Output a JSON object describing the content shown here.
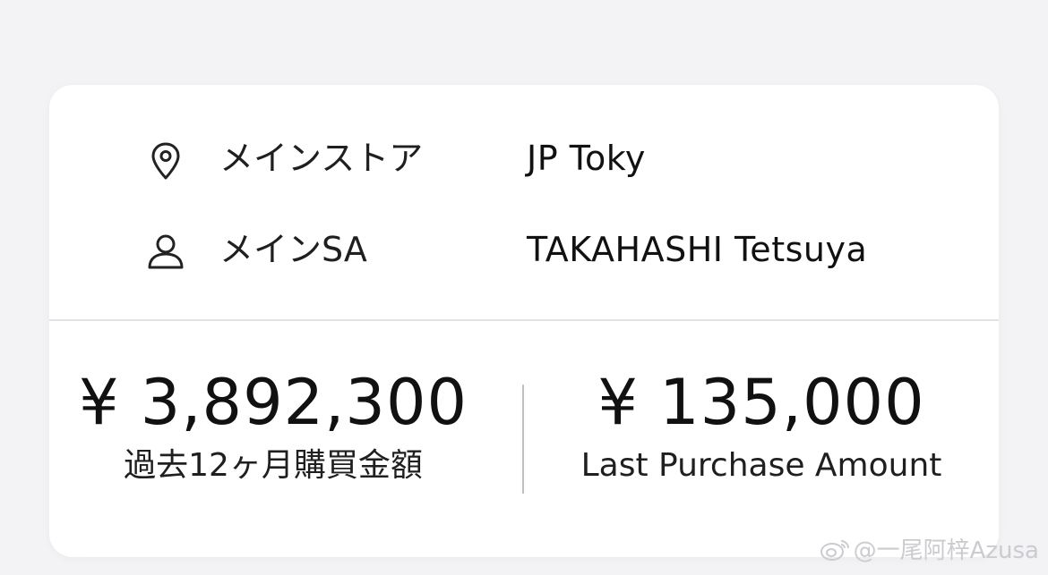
{
  "main_info": {
    "store_label": "メインストア",
    "store_value": "JP Toky",
    "store_icon": "location-pin-icon",
    "sa_label": "メインSA",
    "sa_value": "TAKAHASHI Tetsuya",
    "sa_icon": "person-icon"
  },
  "stats": {
    "past_12m_amount": "¥ 3,892,300",
    "past_12m_caption": "過去12ヶ月購買金額",
    "last_purchase_amount": "¥ 135,000",
    "last_purchase_caption": "Last Purchase Amount"
  },
  "watermark": {
    "text": "@一尾阿梓Azusa",
    "icon": "weibo-icon"
  }
}
